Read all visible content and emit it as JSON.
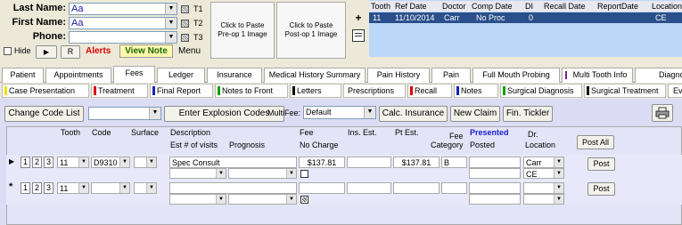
{
  "header": {
    "last_name_label": "Last Name:",
    "last_name_value": "Aa",
    "first_name_label": "First Name:",
    "first_name_value": "Aa",
    "phone_label": "Phone:",
    "phone_value": "",
    "t1": "T1",
    "t2": "T2",
    "t3": "T3",
    "hide_label": "Hide",
    "r_label": "R",
    "alerts_label": "Alerts",
    "view_note_label": "View Note",
    "menu_label": "Menu",
    "paste_preop_line1": "Click to Paste",
    "paste_preop_line2": "Pre-op 1 Image",
    "paste_postop_line1": "Click to Paste",
    "paste_postop_line2": "Post-op 1 Image"
  },
  "history": {
    "columns": [
      "Tooth",
      "Ref Date",
      "Doctor",
      "Comp Date",
      "DI",
      "Recall Date",
      "ReportDate",
      "Location"
    ],
    "rows": [
      [
        "11",
        "11/10/2014",
        "Carr",
        "No Proc",
        "0",
        "",
        "",
        "CE"
      ]
    ]
  },
  "tabs": [
    "Patient",
    "Appointments",
    "Fees",
    "Ledger",
    "Insurance",
    "Medical History Summary",
    "Pain History",
    "Pain",
    "Full Mouth Probing",
    "Multi Tooth Info",
    "Diagno"
  ],
  "selected_tab": "Fees",
  "category_tabs": [
    {
      "label": "Case Presentation",
      "color": "#f0e000"
    },
    {
      "label": "Treatment",
      "color": "#e00000"
    },
    {
      "label": "Final Report",
      "color": "#1020c0"
    },
    {
      "label": "Notes to Front",
      "color": "#10a010"
    },
    {
      "label": "Letters",
      "color": "#000000"
    },
    {
      "label": "Prescriptions",
      "color": ""
    },
    {
      "label": "Recall",
      "color": "#e00000"
    },
    {
      "label": "Notes",
      "color": "#1020c0"
    },
    {
      "label": "Surgical Diagnosis",
      "color": "#10a010"
    },
    {
      "label": "Surgical Treatment",
      "color": "#000000"
    },
    {
      "label": "Ev",
      "color": ""
    }
  ],
  "toolbar": {
    "change_code_list": "Change Code List",
    "enter_explosion_codes": "Enter Explosion Codes",
    "multifee_label": "MultiFee:",
    "multifee_value": "Default",
    "calc_insurance": "Calc. Insurance",
    "new_claim": "New Claim",
    "fin_tickler": "Fin. Tickler",
    "print_icon": "printer-icon"
  },
  "grid": {
    "h_tooth": "Tooth",
    "h_code": "Code",
    "h_surface": "Surface",
    "h_description": "Description",
    "h_est_visits": "Est # of visits",
    "h_prognosis": "Prognosis",
    "h_fee": "Fee",
    "h_no_charge": "No Charge",
    "h_ins_est": "Ins. Est.",
    "h_pt_est": "Pt Est.",
    "h_fee_category": "Fee\nCategory",
    "h_fee_line1": "Fee",
    "h_fee_line2": "Category",
    "h_presented": "Presented",
    "h_posted": "Posted",
    "h_dr": "Dr.",
    "h_location": "Location",
    "post_all": "Post All",
    "row1": {
      "nums": [
        "1",
        "2",
        "3"
      ],
      "tooth": "11",
      "code": "D9310",
      "surface": "",
      "description": "Spec Consult",
      "fee": "$137.81",
      "ins_est": "",
      "pt_est": "$137.81",
      "fee_category": "B",
      "dr": "Carr",
      "location": "CE",
      "post": "Post"
    },
    "row2": {
      "nums": [
        "1",
        "2",
        "3"
      ],
      "tooth": "11",
      "post": "Post"
    }
  },
  "colors": {
    "history_bg": "#bcd7f7",
    "history_selected": "#2a4f8a",
    "grid_bg": "#dcdcf4",
    "presented": "#1a1ad0"
  }
}
